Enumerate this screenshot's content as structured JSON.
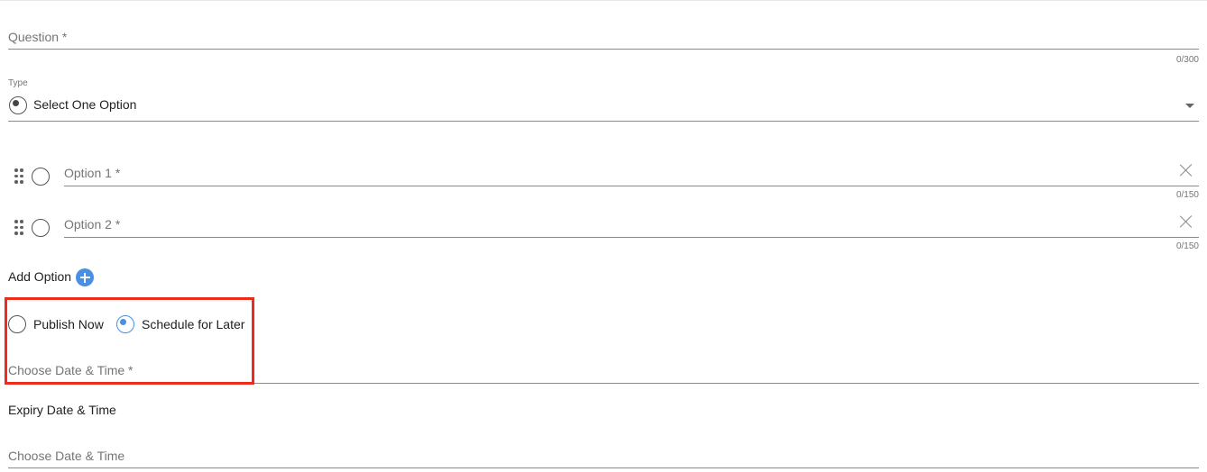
{
  "question": {
    "placeholder": "Question *",
    "counter": "0/300"
  },
  "type": {
    "label": "Type",
    "value": "Select One Option",
    "icon": "radio-checked-icon"
  },
  "options": [
    {
      "placeholder": "Option 1 *",
      "counter": "0/150"
    },
    {
      "placeholder": "Option 2 *",
      "counter": "0/150"
    }
  ],
  "add_option": {
    "label": "Add Option",
    "icon": "plus-circle-icon"
  },
  "publish": {
    "now_label": "Publish Now",
    "later_label": "Schedule for Later",
    "selected": "later",
    "date_placeholder": "Choose Date & Time *"
  },
  "expiry": {
    "label": "Expiry Date & Time",
    "placeholder": "Choose Date & Time"
  },
  "colors": {
    "accent": "#4a90e2",
    "highlight": "#ee2a1b"
  }
}
